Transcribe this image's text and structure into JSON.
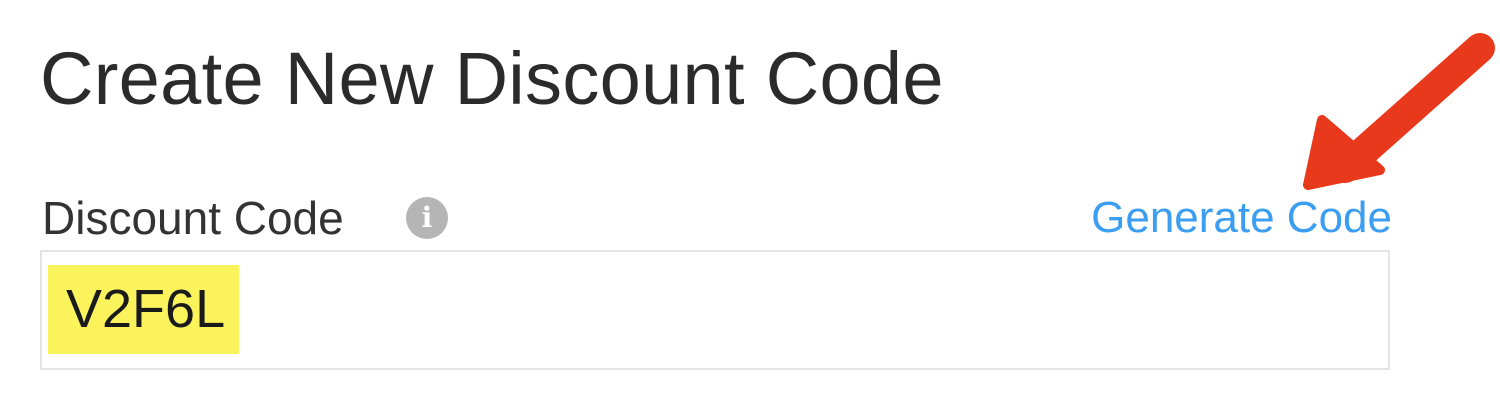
{
  "title": "Create New Discount Code",
  "discount_field": {
    "label": "Discount Code",
    "info_icon": "info-icon",
    "generate_label": "Generate Code",
    "value": "V2F6L"
  },
  "colors": {
    "link": "#3b9ef0",
    "highlight": "#fbf35c",
    "arrow": "#e8391c",
    "info_icon": "#b5b5b5"
  }
}
